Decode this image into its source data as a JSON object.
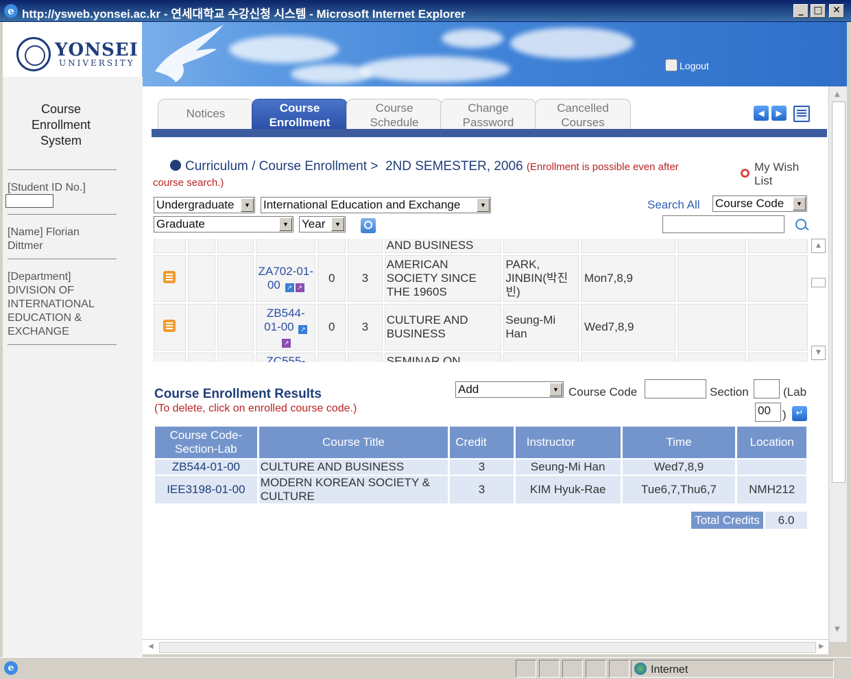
{
  "window": {
    "title": "http://ysweb.yonsei.ac.kr - 연세대학교 수강신청 시스템 - Microsoft Internet Explorer",
    "min": "_",
    "max": "□",
    "close": "✕"
  },
  "header": {
    "logo_main": "YONSEI",
    "logo_sub": "UNIVERSITY",
    "logout": "Logout"
  },
  "sidebar": {
    "title_lines": [
      "Course",
      "Enrollment",
      "System"
    ],
    "student_id_label": "[Student ID No.]",
    "name_label": "[Name] Florian Dittmer",
    "department_label": "[Department] DIVISION OF INTERNATIONAL EDUCATION & EXCHANGE"
  },
  "tabs": [
    {
      "l1": "Notices",
      "l2": ""
    },
    {
      "l1": "Course",
      "l2": "Enrollment"
    },
    {
      "l1": "Course",
      "l2": "Schedule"
    },
    {
      "l1": "Change",
      "l2": "Password"
    },
    {
      "l1": "Cancelled",
      "l2": "Courses"
    }
  ],
  "breadcrumb": {
    "path": "Curriculum / Course Enrollment >",
    "semester": "2ND SEMESTER, 2006",
    "note_a": "(Enrollment is possible even after",
    "note_b": "course search.)"
  },
  "wishlist": {
    "l1": "My Wish",
    "l2": "List"
  },
  "filters": {
    "level": "Undergraduate",
    "department": "International Education and Exchange",
    "program": "Graduate",
    "year": "Year",
    "search_all": "Search All",
    "search_by": "Course Code",
    "search_value": ""
  },
  "courses": {
    "top_partial_title": "AND BUSINESS",
    "rows": [
      {
        "code_a": "ZA702-01-",
        "code_b": "00",
        "col5": "0",
        "credit": "3",
        "title": "AMERICAN SOCIETY SINCE THE 1960S",
        "instructor": "PARK, JINBIN(박진빈)",
        "time": "Mon7,8,9"
      },
      {
        "code_a": "ZB544-",
        "code_b": "01-00",
        "col5": "0",
        "credit": "3",
        "title": "CULTURE AND BUSINESS",
        "instructor": "Seung-Mi Han",
        "time": "Wed7,8,9"
      }
    ],
    "bottom_partial_code": "ZC555-",
    "bottom_partial_title": "SEMINAR ON"
  },
  "results": {
    "title": "Course Enrollment Results",
    "note": "(To delete, click on enrolled course code.)",
    "action": "Add",
    "course_code_label": "Course Code",
    "section_label": "Section",
    "lab_label": "(Lab",
    "lab_value": "00",
    "lab_close": ")",
    "headers": {
      "code": "Course Code-Section-Lab",
      "title": "Course Title",
      "credit": "Credit",
      "instructor": "Instructor",
      "time": "Time",
      "location": "Location"
    },
    "rows": [
      {
        "code": "ZB544-01-00",
        "title": "CULTURE AND BUSINESS",
        "credit": "3",
        "instructor": "Seung-Mi Han",
        "time": "Wed7,8,9",
        "location": ""
      },
      {
        "code": "IEE3198-01-00",
        "title": "MODERN KOREAN SOCIETY & CULTURE",
        "credit": "3",
        "instructor": "KIM Hyuk-Rae",
        "time": "Tue6,7,Thu6,7",
        "location": "NMH212"
      }
    ],
    "total_label": "Total Credits",
    "total_value": "6.0"
  },
  "statusbar": {
    "zone": "Internet"
  }
}
